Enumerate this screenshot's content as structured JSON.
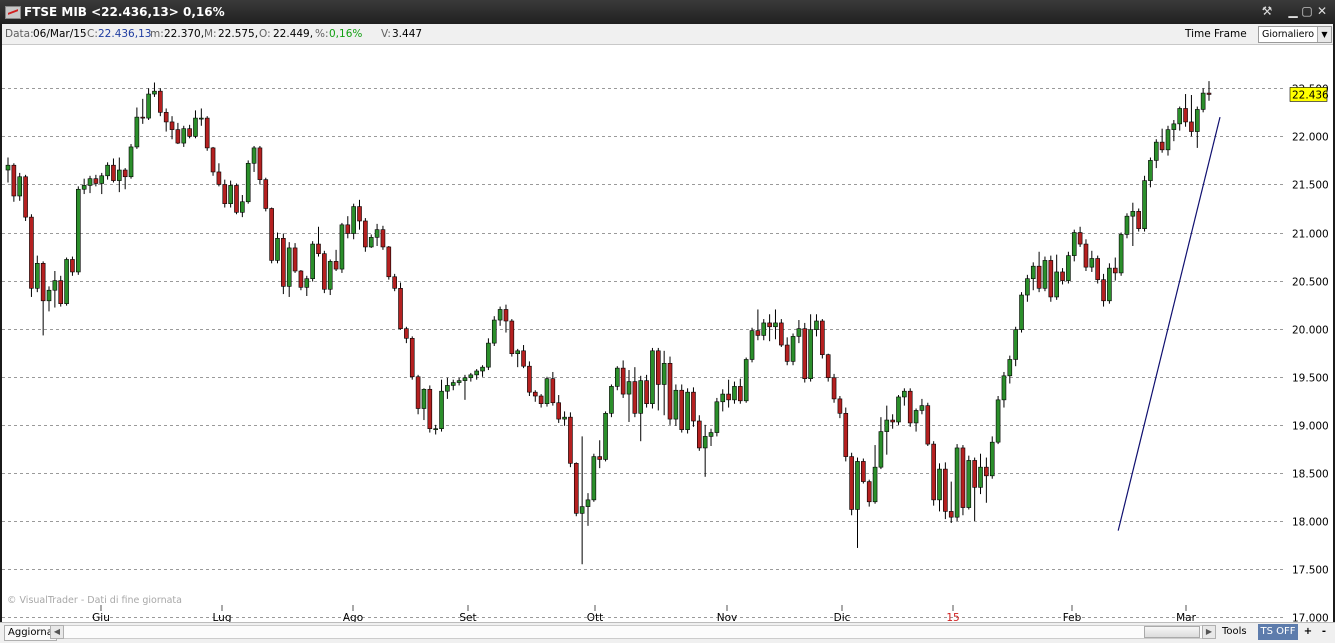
{
  "window": {
    "title": "FTSE MIB <22.436,13> 0,16%",
    "icons": [
      "chart-app-icon",
      "tools-icon",
      "minimize-icon",
      "restore-icon",
      "close-icon"
    ]
  },
  "info": {
    "data_label": "Data:",
    "data_value": "06/Mar/15",
    "close_label": "C:",
    "close_value": "22.436,13",
    "min_label": "m:",
    "min_value": "22.370,",
    "max_label": "M:",
    "max_value": "22.575,",
    "open_label": "O:",
    "open_value": "22.449,",
    "pct_label": "%:",
    "pct_value": "0,16%",
    "vol_label": "V:",
    "vol_value": "3.447",
    "timeframe_label": "Time Frame",
    "timeframe_value": "Giornaliero"
  },
  "chart_data": {
    "type": "candlestick",
    "yticks": [
      "17.000",
      "17.500",
      "18.000",
      "18.500",
      "19.000",
      "19.500",
      "20.000",
      "20.500",
      "21.000",
      "21.500",
      "22.000",
      "22.500"
    ],
    "ylim": [
      16950,
      22950
    ],
    "grid": "horizontal dashed",
    "x_month_labels": [
      "Giu",
      "Lug",
      "Ago",
      "Set",
      "Ott",
      "Nov",
      "Dic",
      "15",
      "Feb",
      "Mar"
    ],
    "last_price_label": "22.436",
    "watermark": "© VisualTrader - Dati di fine giornata",
    "trendline": {
      "from_value": 17900,
      "to_value": 22200
    },
    "candles_ohlc": [
      [
        21650,
        21780,
        21520,
        21700
      ],
      [
        21700,
        21720,
        21320,
        21380
      ],
      [
        21380,
        21620,
        21330,
        21580
      ],
      [
        21580,
        21600,
        21120,
        21160
      ],
      [
        21160,
        21190,
        20330,
        20420
      ],
      [
        20420,
        20760,
        20380,
        20680
      ],
      [
        20680,
        20700,
        19930,
        20290
      ],
      [
        20290,
        20440,
        20180,
        20400
      ],
      [
        20400,
        20600,
        20220,
        20500
      ],
      [
        20500,
        20550,
        20230,
        20260
      ],
      [
        20260,
        20740,
        20240,
        20720
      ],
      [
        20720,
        20750,
        20550,
        20590
      ],
      [
        20590,
        21480,
        20560,
        21450
      ],
      [
        21450,
        21560,
        21400,
        21490
      ],
      [
        21490,
        21590,
        21410,
        21560
      ],
      [
        21560,
        21600,
        21480,
        21510
      ],
      [
        21510,
        21620,
        21400,
        21590
      ],
      [
        21590,
        21730,
        21550,
        21700
      ],
      [
        21700,
        21770,
        21520,
        21540
      ],
      [
        21540,
        21780,
        21420,
        21650
      ],
      [
        21650,
        21670,
        21450,
        21580
      ],
      [
        21580,
        21920,
        21560,
        21890
      ],
      [
        21890,
        22300,
        21870,
        22200
      ],
      [
        22200,
        22390,
        22130,
        22190
      ],
      [
        22190,
        22500,
        22170,
        22440
      ],
      [
        22440,
        22560,
        22410,
        22470
      ],
      [
        22470,
        22500,
        22210,
        22250
      ],
      [
        22250,
        22290,
        22050,
        22150
      ],
      [
        22150,
        22210,
        21970,
        22070
      ],
      [
        22070,
        22140,
        21920,
        21930
      ],
      [
        21930,
        22110,
        21890,
        22080
      ],
      [
        22080,
        22120,
        21980,
        22000
      ],
      [
        22000,
        22270,
        21980,
        22190
      ],
      [
        22190,
        22290,
        22110,
        22190
      ],
      [
        22190,
        22210,
        21850,
        21880
      ],
      [
        21880,
        21890,
        21590,
        21630
      ],
      [
        21630,
        21720,
        21480,
        21500
      ],
      [
        21500,
        21550,
        21260,
        21300
      ],
      [
        21300,
        21540,
        21260,
        21490
      ],
      [
        21490,
        21510,
        21190,
        21210
      ],
      [
        21210,
        21390,
        21160,
        21320
      ],
      [
        21320,
        21750,
        21300,
        21720
      ],
      [
        21720,
        21900,
        21630,
        21880
      ],
      [
        21880,
        21900,
        21500,
        21550
      ],
      [
        21550,
        21570,
        21220,
        21250
      ],
      [
        21250,
        21260,
        20680,
        20710
      ],
      [
        20710,
        21000,
        20680,
        20940
      ],
      [
        20940,
        20990,
        20360,
        20440
      ],
      [
        20440,
        20900,
        20330,
        20840
      ],
      [
        20840,
        20890,
        20580,
        20600
      ],
      [
        20600,
        20610,
        20400,
        20430
      ],
      [
        20430,
        20550,
        20340,
        20520
      ],
      [
        20520,
        20910,
        20490,
        20880
      ],
      [
        20880,
        21060,
        20750,
        20780
      ],
      [
        20780,
        20810,
        20370,
        20410
      ],
      [
        20410,
        20720,
        20350,
        20700
      ],
      [
        20700,
        20820,
        20600,
        20620
      ],
      [
        20620,
        21100,
        20580,
        21080
      ],
      [
        21080,
        21170,
        20940,
        20990
      ],
      [
        20990,
        21300,
        20930,
        21270
      ],
      [
        21270,
        21340,
        21030,
        21120
      ],
      [
        21120,
        21150,
        20800,
        20850
      ],
      [
        20850,
        20980,
        20840,
        20950
      ],
      [
        20950,
        21090,
        20860,
        21030
      ],
      [
        21030,
        21070,
        20820,
        20850
      ],
      [
        20850,
        20860,
        20510,
        20540
      ],
      [
        20540,
        20570,
        20390,
        20420
      ],
      [
        20420,
        20480,
        19990,
        20000
      ],
      [
        20000,
        20020,
        19850,
        19900
      ],
      [
        19900,
        19920,
        19470,
        19500
      ],
      [
        19500,
        19520,
        19110,
        19170
      ],
      [
        19170,
        19380,
        19050,
        19370
      ],
      [
        19370,
        19410,
        18920,
        18960
      ],
      [
        18960,
        19000,
        18900,
        18960
      ],
      [
        18960,
        19470,
        18930,
        19350
      ],
      [
        19350,
        19490,
        19270,
        19410
      ],
      [
        19410,
        19470,
        19360,
        19440
      ],
      [
        19440,
        19490,
        19410,
        19460
      ],
      [
        19460,
        19520,
        19260,
        19490
      ],
      [
        19490,
        19540,
        19450,
        19520
      ],
      [
        19520,
        19580,
        19470,
        19560
      ],
      [
        19560,
        19620,
        19500,
        19600
      ],
      [
        19600,
        19900,
        19570,
        19850
      ],
      [
        19850,
        20130,
        19820,
        20090
      ],
      [
        20090,
        20230,
        20030,
        20200
      ],
      [
        20200,
        20250,
        19960,
        20080
      ],
      [
        20080,
        20100,
        19710,
        19740
      ],
      [
        19740,
        19790,
        19600,
        19770
      ],
      [
        19770,
        19830,
        19590,
        19610
      ],
      [
        19610,
        19660,
        19300,
        19340
      ],
      [
        19340,
        19360,
        19240,
        19300
      ],
      [
        19300,
        19320,
        19180,
        19220
      ],
      [
        19220,
        19500,
        19190,
        19480
      ],
      [
        19480,
        19550,
        19200,
        19230
      ],
      [
        19230,
        19310,
        19020,
        19060
      ],
      [
        19060,
        19140,
        18990,
        19080
      ],
      [
        19080,
        19130,
        18560,
        18600
      ],
      [
        18600,
        18610,
        18050,
        18080
      ],
      [
        18080,
        18880,
        17550,
        18150
      ],
      [
        18150,
        18290,
        17950,
        18220
      ],
      [
        18220,
        18700,
        18200,
        18670
      ],
      [
        18670,
        18840,
        18550,
        18640
      ],
      [
        18640,
        19140,
        18620,
        19120
      ],
      [
        19120,
        19420,
        19080,
        19400
      ],
      [
        19400,
        19610,
        19360,
        19590
      ],
      [
        19590,
        19670,
        19280,
        19320
      ],
      [
        19320,
        19570,
        19030,
        19450
      ],
      [
        19450,
        19600,
        19080,
        19120
      ],
      [
        19120,
        19510,
        18830,
        19460
      ],
      [
        19460,
        19520,
        19180,
        19220
      ],
      [
        19220,
        19800,
        19170,
        19770
      ],
      [
        19770,
        19800,
        19150,
        19420
      ],
      [
        19420,
        19770,
        19100,
        19640
      ],
      [
        19640,
        19710,
        19000,
        19060
      ],
      [
        19060,
        19420,
        18990,
        19360
      ],
      [
        19360,
        19420,
        18920,
        18950
      ],
      [
        18950,
        19380,
        18910,
        19340
      ],
      [
        19340,
        19390,
        18980,
        19040
      ],
      [
        19040,
        19100,
        18730,
        18760
      ],
      [
        18760,
        19000,
        18460,
        18880
      ],
      [
        18880,
        18960,
        18780,
        18920
      ],
      [
        18920,
        19280,
        18880,
        19240
      ],
      [
        19240,
        19370,
        19140,
        19320
      ],
      [
        19320,
        19470,
        19180,
        19260
      ],
      [
        19260,
        19450,
        19220,
        19400
      ],
      [
        19400,
        19480,
        19220,
        19250
      ],
      [
        19250,
        19700,
        19230,
        19680
      ],
      [
        19680,
        20010,
        19650,
        19980
      ],
      [
        19980,
        20200,
        19880,
        19930
      ],
      [
        19930,
        20100,
        19880,
        20060
      ],
      [
        20060,
        20150,
        19870,
        20020
      ],
      [
        20020,
        20200,
        19890,
        20060
      ],
      [
        20060,
        20100,
        19810,
        19830
      ],
      [
        19830,
        19910,
        19620,
        19660
      ],
      [
        19660,
        19950,
        19620,
        19920
      ],
      [
        19920,
        20090,
        19850,
        20000
      ],
      [
        20000,
        20060,
        19440,
        19480
      ],
      [
        19480,
        20150,
        19450,
        19990
      ],
      [
        19990,
        20150,
        19920,
        20080
      ],
      [
        20080,
        20100,
        19690,
        19730
      ],
      [
        19730,
        19740,
        19450,
        19490
      ],
      [
        19490,
        19530,
        19230,
        19270
      ],
      [
        19270,
        19300,
        19070,
        19120
      ],
      [
        19120,
        19180,
        18620,
        18670
      ],
      [
        18670,
        18710,
        18060,
        18120
      ],
      [
        18120,
        18660,
        17720,
        18620
      ],
      [
        18620,
        18650,
        18390,
        18410
      ],
      [
        18410,
        18430,
        18150,
        18200
      ],
      [
        18200,
        18790,
        18180,
        18560
      ],
      [
        18560,
        19080,
        18540,
        18930
      ],
      [
        18930,
        19200,
        18690,
        19050
      ],
      [
        19050,
        19110,
        18960,
        19030
      ],
      [
        19030,
        19310,
        19000,
        19290
      ],
      [
        19290,
        19380,
        19200,
        19350
      ],
      [
        19350,
        19380,
        18980,
        19020
      ],
      [
        19020,
        19170,
        18930,
        19150
      ],
      [
        19150,
        19270,
        19110,
        19200
      ],
      [
        19200,
        19230,
        18780,
        18800
      ],
      [
        18800,
        18830,
        18160,
        18220
      ],
      [
        18220,
        18600,
        18100,
        18540
      ],
      [
        18540,
        18610,
        18020,
        18100
      ],
      [
        18100,
        18410,
        17980,
        18040
      ],
      [
        18040,
        18800,
        18000,
        18760
      ],
      [
        18760,
        18790,
        18060,
        18140
      ],
      [
        18140,
        18680,
        18120,
        18630
      ],
      [
        18630,
        18660,
        18000,
        18350
      ],
      [
        18350,
        18700,
        18280,
        18560
      ],
      [
        18560,
        18660,
        18190,
        18470
      ],
      [
        18470,
        18880,
        18440,
        18820
      ],
      [
        18820,
        19300,
        18800,
        19260
      ],
      [
        19260,
        19550,
        19180,
        19510
      ],
      [
        19510,
        19720,
        19430,
        19680
      ],
      [
        19680,
        20020,
        19610,
        19990
      ],
      [
        19990,
        20380,
        19960,
        20350
      ],
      [
        20350,
        20560,
        20280,
        20520
      ],
      [
        20520,
        20690,
        20400,
        20650
      ],
      [
        20650,
        20800,
        20380,
        20420
      ],
      [
        20420,
        20750,
        20390,
        20710
      ],
      [
        20710,
        20760,
        20280,
        20330
      ],
      [
        20330,
        20770,
        20300,
        20590
      ],
      [
        20590,
        20630,
        20460,
        20500
      ],
      [
        20500,
        20800,
        20470,
        20760
      ],
      [
        20760,
        21030,
        20700,
        21000
      ],
      [
        21000,
        21060,
        20850,
        20880
      ],
      [
        20880,
        20930,
        20600,
        20640
      ],
      [
        20640,
        20810,
        20590,
        20730
      ],
      [
        20730,
        20760,
        20470,
        20510
      ],
      [
        20510,
        20570,
        20230,
        20290
      ],
      [
        20290,
        20680,
        20260,
        20630
      ],
      [
        20630,
        20740,
        20500,
        20580
      ],
      [
        20580,
        21000,
        20550,
        20980
      ],
      [
        20980,
        21200,
        20940,
        21170
      ],
      [
        21170,
        21310,
        20860,
        21220
      ],
      [
        21220,
        21250,
        21010,
        21040
      ],
      [
        21040,
        21590,
        21010,
        21540
      ],
      [
        21540,
        21780,
        21470,
        21750
      ],
      [
        21750,
        21970,
        21670,
        21940
      ],
      [
        21940,
        22080,
        21830,
        21860
      ],
      [
        21860,
        22110,
        21800,
        22070
      ],
      [
        22070,
        22170,
        21950,
        22130
      ],
      [
        22130,
        22310,
        22060,
        22290
      ],
      [
        22290,
        22440,
        22100,
        22150
      ],
      [
        22150,
        22430,
        22000,
        22050
      ],
      [
        22050,
        22310,
        21880,
        22280
      ],
      [
        22280,
        22500,
        22250,
        22450
      ],
      [
        22450,
        22575,
        22370,
        22436
      ]
    ]
  },
  "bottom": {
    "refresh_label": "Aggiorna",
    "tools_label": "Tools",
    "ts_label": "TS OFF",
    "plus_label": "+",
    "minus_label": "-"
  }
}
